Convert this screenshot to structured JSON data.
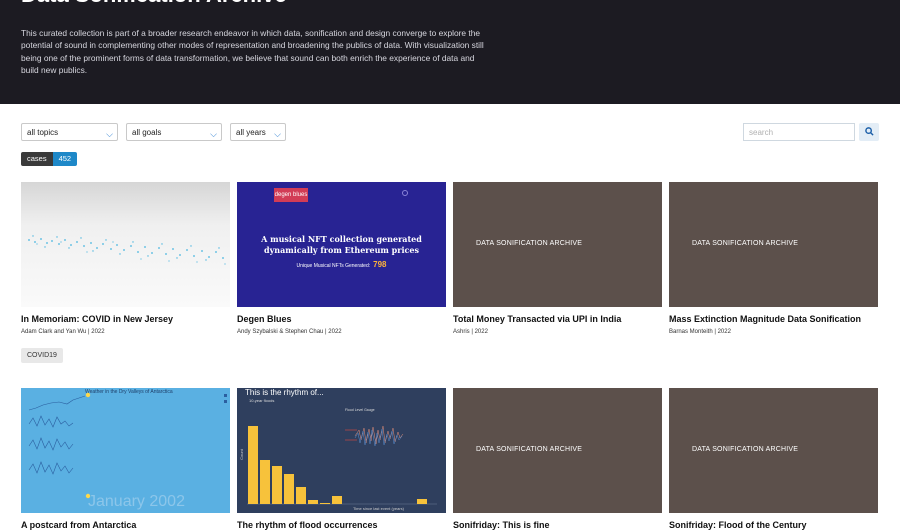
{
  "header": {
    "title": "Data Sonification Archive",
    "description": "This curated collection is part of a broader research endeavor in which data, sonification and design converge to explore the potential of sound in complementing other modes of representation and broadening the publics of data. With visualization still being one of the prominent forms of data transformation, we believe that sound can both enrich the experience of data and build new publics."
  },
  "filters": {
    "topics": "all topics",
    "goals": "all goals",
    "years": "all years",
    "search_placeholder": "search"
  },
  "count": {
    "label": "cases",
    "value": "452"
  },
  "cards": [
    {
      "title": "In Memoriam: COVID in New Jersey",
      "meta": "Adam Clark and Yan Wu | 2022",
      "tag": "COVID19"
    },
    {
      "title": "Degen Blues",
      "meta": "Andy Szybalski & Stephen Chau | 2022",
      "thumb": {
        "logo": "degen blues",
        "headline": "A musical NFT collection generated dynamically from Ethereum prices",
        "sub": "Unique Musical NFTs Generated:",
        "count": "798"
      }
    },
    {
      "title": "Total Money Transacted via UPI in India",
      "meta": "Ashris | 2022",
      "thumb": {
        "placeholder": "DATA SONIFICATION ARCHIVE"
      }
    },
    {
      "title": "Mass Extinction Magnitude Data Sonification",
      "meta": "Barnas Monteith | 2022",
      "thumb": {
        "placeholder": "DATA SONIFICATION ARCHIVE"
      }
    },
    {
      "title": "A postcard from Antarctica",
      "thumb": {
        "caption": "Weather in the Dry Valleys of Antarctica",
        "big": "January 2002"
      }
    },
    {
      "title": "The rhythm of flood occurrences",
      "thumb": {
        "caption": "This is the rhythm of...",
        "sub": "10-year floods",
        "panel": "Flood Level Gauge",
        "ylabel": "Count",
        "xlabel": "Time since last event (years)"
      }
    },
    {
      "title": "Sonifriday: This is fine",
      "thumb": {
        "placeholder": "DATA SONIFICATION ARCHIVE"
      }
    },
    {
      "title": "Sonifriday: Flood of the Century",
      "thumb": {
        "placeholder": "DATA SONIFICATION ARCHIVE"
      }
    }
  ],
  "colors": {
    "header_bg": "#1c1b22",
    "accent": "#1e88c8",
    "placeholder_bg": "#5c504b"
  }
}
